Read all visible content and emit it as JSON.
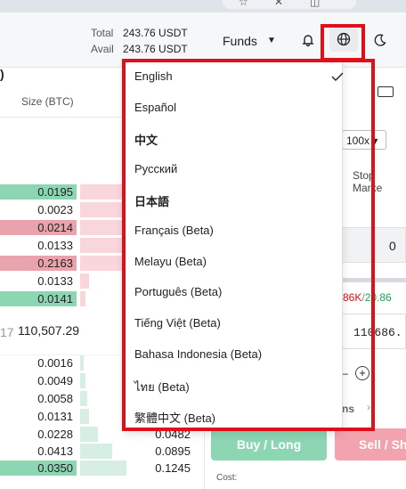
{
  "header": {
    "total_label": "Total",
    "total_value": "243.76 USDT",
    "avail_label": "Avail",
    "avail_value": "243.76 USDT",
    "funds_label": "Funds",
    "icons": [
      "bell-icon",
      "globe-icon",
      "moon-icon"
    ]
  },
  "orderbook": {
    "paren_text": ")",
    "col_size": "Size (BTC)",
    "asks": [
      {
        "size": "0.0195"
      },
      {
        "size": "0.0023"
      },
      {
        "size": "0.0214"
      },
      {
        "size": "0.0133"
      },
      {
        "size": "0.2163"
      },
      {
        "size": "0.0133"
      },
      {
        "size": "0.0141"
      }
    ],
    "mid_prefix": "17",
    "mid_price": "110,507.29",
    "bids": [
      {
        "size": "0.0016",
        "total": ""
      },
      {
        "size": "0.0049",
        "total": ""
      },
      {
        "size": "0.0058",
        "total": ""
      },
      {
        "size": "0.0131",
        "total": ""
      },
      {
        "size": "0.0228",
        "total": "0.0482"
      },
      {
        "size": "0.0413",
        "total": "0.0895"
      },
      {
        "size": "0.0350",
        "total": "0.1245"
      }
    ]
  },
  "trade": {
    "leverage": "100x",
    "stop_tab": "Stop Marke",
    "qty_value": "0",
    "pct_red": "86K",
    "pct_sep": "/",
    "pct_green": "20.86",
    "price_value": "110686.",
    "section_label": "ns",
    "buy_label": "Buy / Long",
    "sell_label": "Sell / Sh",
    "cost_label": "Cost:"
  },
  "language_menu": {
    "items": [
      {
        "label": "English",
        "selected": true
      },
      {
        "label": "Español"
      },
      {
        "label": "中文"
      },
      {
        "label": "Русский"
      },
      {
        "label": "日本語"
      },
      {
        "label": "Français (Beta)"
      },
      {
        "label": "Melayu (Beta)"
      },
      {
        "label": "Português (Beta)"
      },
      {
        "label": "Tiếng Việt (Beta)"
      },
      {
        "label": "Bahasa Indonesia (Beta)"
      },
      {
        "label": "ไทย (Beta)"
      },
      {
        "label": "繁體中文 (Beta)"
      }
    ]
  },
  "colors": {
    "highlight_red": "#e0101a",
    "ask_bar": "#f8d6db",
    "ask_bar_strong": "#e8a3ad",
    "bid_bar": "#d7efe3",
    "bid_bar_strong": "#8cd6b4",
    "buy_button": "#8cd6b4",
    "sell_button": "#f3a3ae"
  }
}
